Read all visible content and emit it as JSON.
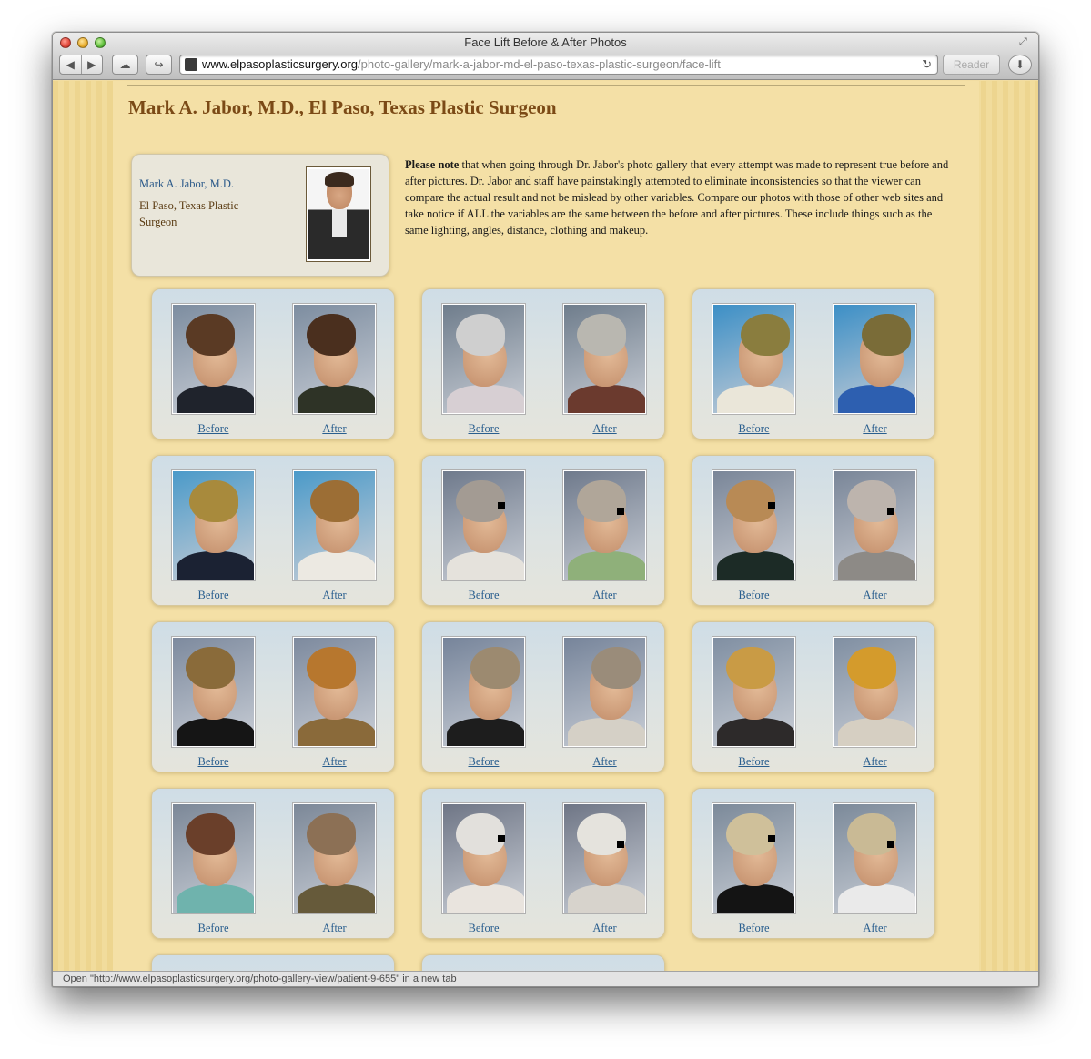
{
  "window": {
    "title": "Face Lift Before & After Photos",
    "reader_label": "Reader",
    "url_host": "www.elpasoplasticsurgery.org",
    "url_path": "/photo-gallery/mark-a-jabor-md-el-paso-texas-plastic-surgeon/face-lift",
    "status_text": "Open \"http://www.elpasoplasticsurgery.org/photo-gallery-view/patient-9-655\" in a new tab"
  },
  "icons": {
    "back": "back-arrow-icon",
    "forward": "forward-arrow-icon",
    "cloud": "icloud-tabs-icon",
    "share": "share-icon",
    "reload": "reload-icon",
    "download": "downloads-icon",
    "fullscreen": "fullscreen-icon"
  },
  "page": {
    "title": "Mark A. Jabor, M.D., El Paso, Texas Plastic Surgeon",
    "profile": {
      "name": "Mark A. Jabor, M.D.",
      "location": "El Paso, Texas Plastic Surgeon"
    },
    "note_bold": "Please note",
    "note_text": " that when going through Dr. Jabor's photo gallery that every attempt was made to represent true before and after pictures. Dr. Jabor and staff have painstakingly attempted to eliminate inconsistencies so that the viewer can compare the actual result and not be mislead by other variables. Compare our photos with those of other web sites and take notice if ALL the variables are the same between the before and after pictures. These include things such as the same lighting, angles, distance, clothing and makeup."
  },
  "colors": {
    "title_brown": "#7b4a16",
    "link_blue": "#2a5f8f",
    "page_bg": "#f4e0a6"
  },
  "gallery": [
    {
      "before": "Before",
      "after": "After",
      "hair_b": "#5a3a24",
      "hair_a": "#4a2f1e",
      "body_b": "#1f232c",
      "body_a": "#2e3326",
      "bg": "#7d8da0",
      "censor": false,
      "facing": "right"
    },
    {
      "before": "Before",
      "after": "After",
      "hair_b": "#cfcfcf",
      "hair_a": "#b9b7b0",
      "body_b": "#d7cfd3",
      "body_a": "#6b3a2e",
      "bg": "#6f7d8c",
      "censor": false,
      "facing": "right"
    },
    {
      "before": "Before",
      "after": "After",
      "hair_b": "#8a7d3e",
      "hair_a": "#7a6c38",
      "body_b": "#eae6d9",
      "body_a": "#2d5fb0",
      "bg": "#3c8fc6",
      "censor": false,
      "facing": "left"
    },
    {
      "before": "Before",
      "after": "After",
      "hair_b": "#a88a3c",
      "hair_a": "#9c6e35",
      "body_b": "#1b2233",
      "body_a": "#ece9e2",
      "bg": "#4b9ac9",
      "censor": false,
      "facing": "front"
    },
    {
      "before": "Before",
      "after": "After",
      "hair_b": "#a39b93",
      "hair_a": "#b0a699",
      "body_b": "#e5e2dc",
      "body_a": "#8fb07a",
      "bg": "#6f7a8c",
      "censor": true,
      "facing": "right"
    },
    {
      "before": "Before",
      "after": "After",
      "hair_b": "#b88a55",
      "hair_a": "#bdb4ad",
      "body_b": "#1c2b26",
      "body_a": "#8d8a86",
      "bg": "#7a8698",
      "censor": true,
      "facing": "right"
    },
    {
      "before": "Before",
      "after": "After",
      "hair_b": "#8a6b3a",
      "hair_a": "#b7772e",
      "body_b": "#151515",
      "body_a": "#8a6a3a",
      "bg": "#7d8a9e",
      "censor": false,
      "facing": "right"
    },
    {
      "before": "Before",
      "after": "After",
      "hair_b": "#9c8a70",
      "hair_a": "#9a8c7a",
      "body_b": "#1d1d1d",
      "body_a": "#d5d0c6",
      "bg": "#76849a",
      "censor": false,
      "facing": "left"
    },
    {
      "before": "Before",
      "after": "After",
      "hair_b": "#c99b45",
      "hair_a": "#d49b2c",
      "body_b": "#2d2a2a",
      "body_a": "#d6cfc2",
      "bg": "#808fa2",
      "censor": false,
      "facing": "right"
    },
    {
      "before": "Before",
      "after": "After",
      "hair_b": "#6a3f2a",
      "hair_a": "#8c7055",
      "body_b": "#6fb3ad",
      "body_a": "#665a3a",
      "bg": "#7c8898",
      "censor": false,
      "facing": "right"
    },
    {
      "before": "Before",
      "after": "After",
      "hair_b": "#e2e0dc",
      "hair_a": "#e5e3dd",
      "body_b": "#e9e4de",
      "body_a": "#d7d3cc",
      "bg": "#6f7686",
      "censor": true,
      "facing": "right"
    },
    {
      "before": "Before",
      "after": "After",
      "hair_b": "#cfc09a",
      "hair_a": "#c9ba95",
      "body_b": "#141414",
      "body_a": "#eaeaea",
      "bg": "#7c8a9a",
      "censor": true,
      "facing": "right"
    }
  ]
}
